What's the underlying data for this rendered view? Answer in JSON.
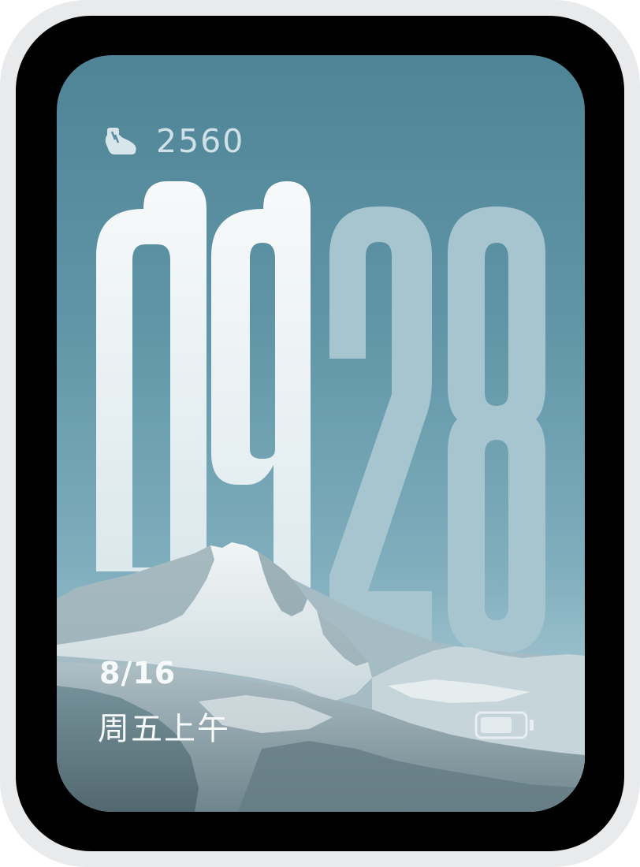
{
  "steps": {
    "icon": "shoe-icon",
    "value": "2560"
  },
  "clock": {
    "hour_digit_1": "0",
    "hour_digit_2": "9",
    "minute_digit_1": "2",
    "minute_digit_2": "8"
  },
  "date": {
    "month_day": "8/16",
    "weekday_period": "周五上午"
  },
  "battery": {
    "icon": "battery-icon",
    "level": 0.75
  },
  "colors": {
    "sky_top": "#4f8496",
    "sky_bottom": "#b9d2da",
    "hour_digits": "#f2f6f8",
    "minute_digits": "#a9c6d0",
    "text": "#f7fafb",
    "bezel": "#000000",
    "frame": "#e9eaec"
  }
}
